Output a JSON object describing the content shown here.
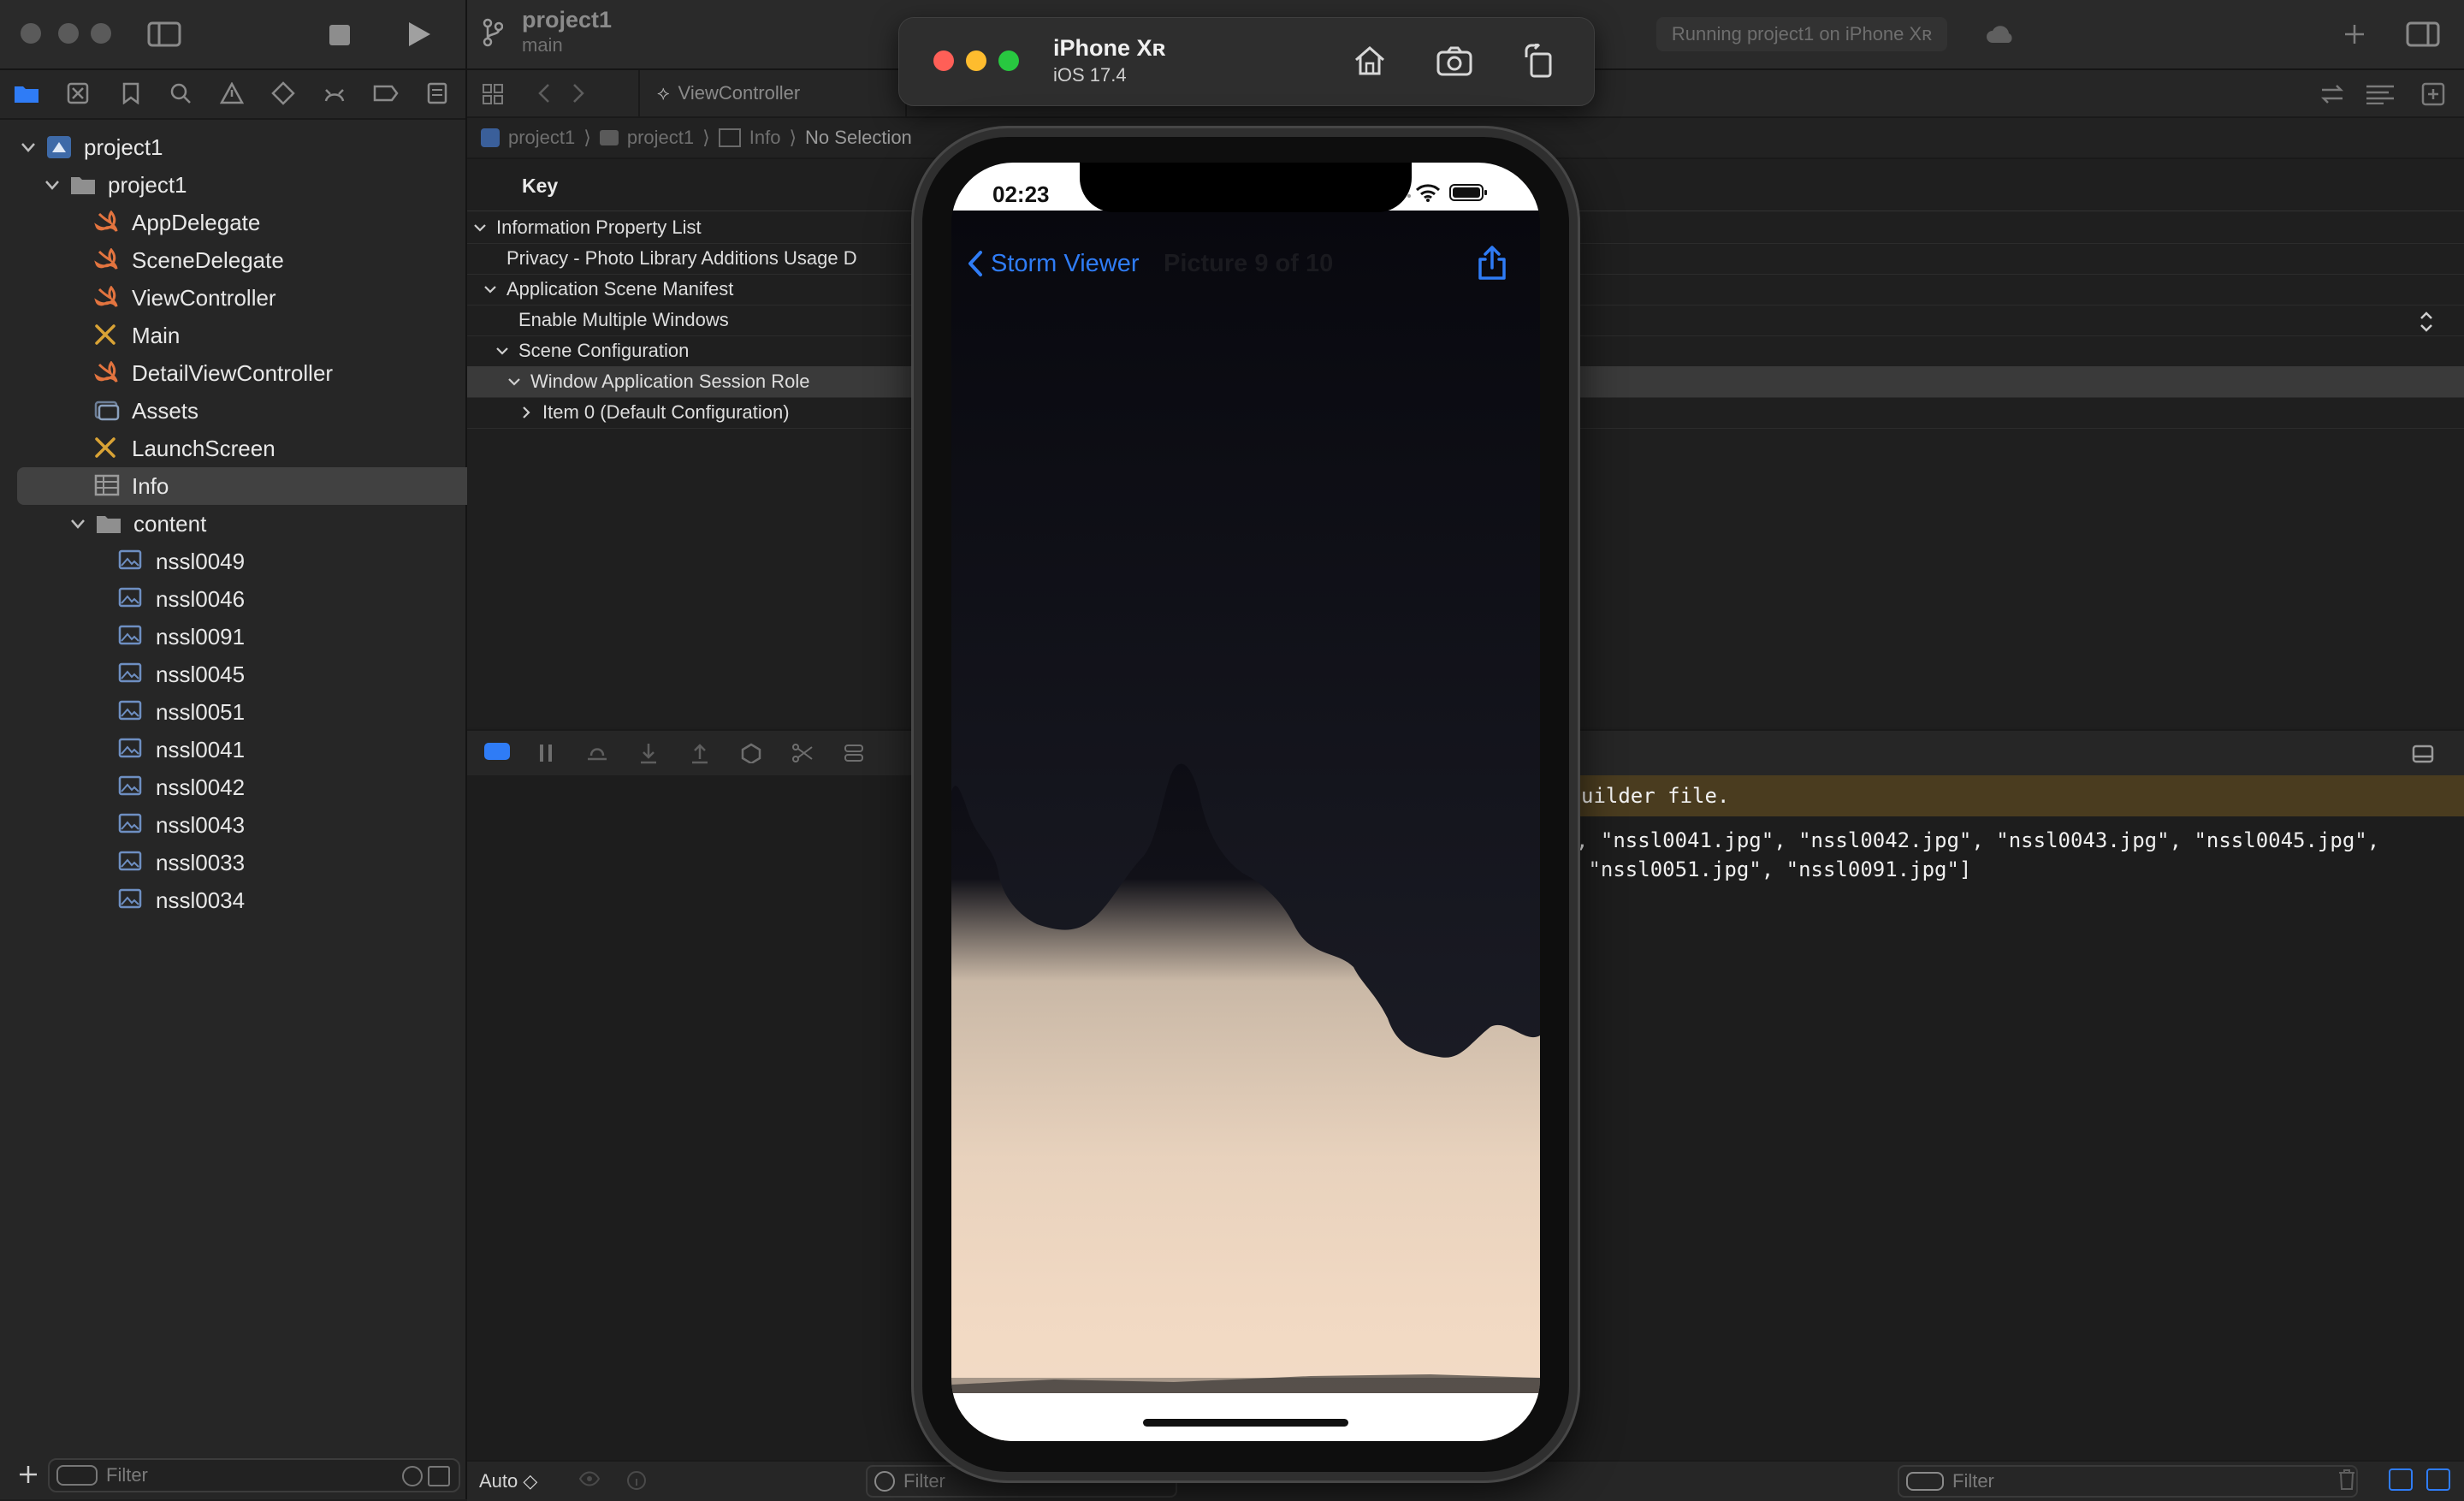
{
  "navigator": {
    "project_root": "project1",
    "group": "project1",
    "files": [
      {
        "label": "AppDelegate",
        "icon": "swift-file-icon"
      },
      {
        "label": "SceneDelegate",
        "icon": "swift-file-icon"
      },
      {
        "label": "ViewController",
        "icon": "swift-file-icon"
      },
      {
        "label": "Main",
        "icon": "storyboard-file-icon"
      },
      {
        "label": "DetailViewController",
        "icon": "swift-file-icon"
      },
      {
        "label": "Assets",
        "icon": "asset-catalog-icon"
      },
      {
        "label": "LaunchScreen",
        "icon": "storyboard-file-icon"
      },
      {
        "label": "Info",
        "icon": "plist-file-icon",
        "selected": true
      }
    ],
    "content_folder": "content",
    "content_files": [
      "nssl0049",
      "nssl0046",
      "nssl0091",
      "nssl0045",
      "nssl0051",
      "nssl0041",
      "nssl0042",
      "nssl0043",
      "nssl0033",
      "nssl0034"
    ],
    "filter_placeholder": "Filter"
  },
  "toolbar": {
    "project": "project1",
    "branch": "main",
    "run_status": "Running project1 on iPhone Xʀ"
  },
  "tabbar": {
    "tab_label": "ViewController"
  },
  "jumpbar": {
    "crumbs": [
      "project1",
      "project1",
      "Info",
      "No Selection"
    ]
  },
  "plist": {
    "key_header": "Key",
    "rows": [
      "Information Property List",
      "Privacy - Photo Library Additions Usage D",
      "Application Scene Manifest",
      "Enable Multiple Windows",
      "Scene Configuration",
      "Window Application Session Role",
      "Item 0 (Default Configuration)"
    ]
  },
  "console": {
    "warning": "uilder file.",
    "line1": ", \"nssl0041.jpg\", \"nssl0042.jpg\", \"nssl0043.jpg\", \"nssl0045.jpg\",",
    "line2": " \"nssl0051.jpg\", \"nssl0091.jpg\"]"
  },
  "statusbar": {
    "auto_label": "Auto ◇",
    "filter_placeholder": "Filter",
    "filter2_placeholder": "Filter"
  },
  "simulator": {
    "device_name": "iPhone Xʀ",
    "os_version": "iOS 17.4",
    "time": "02:23",
    "back_label": "Storm Viewer",
    "nav_title": "Picture 9 of 10",
    "accent": "#2f7cf6"
  }
}
